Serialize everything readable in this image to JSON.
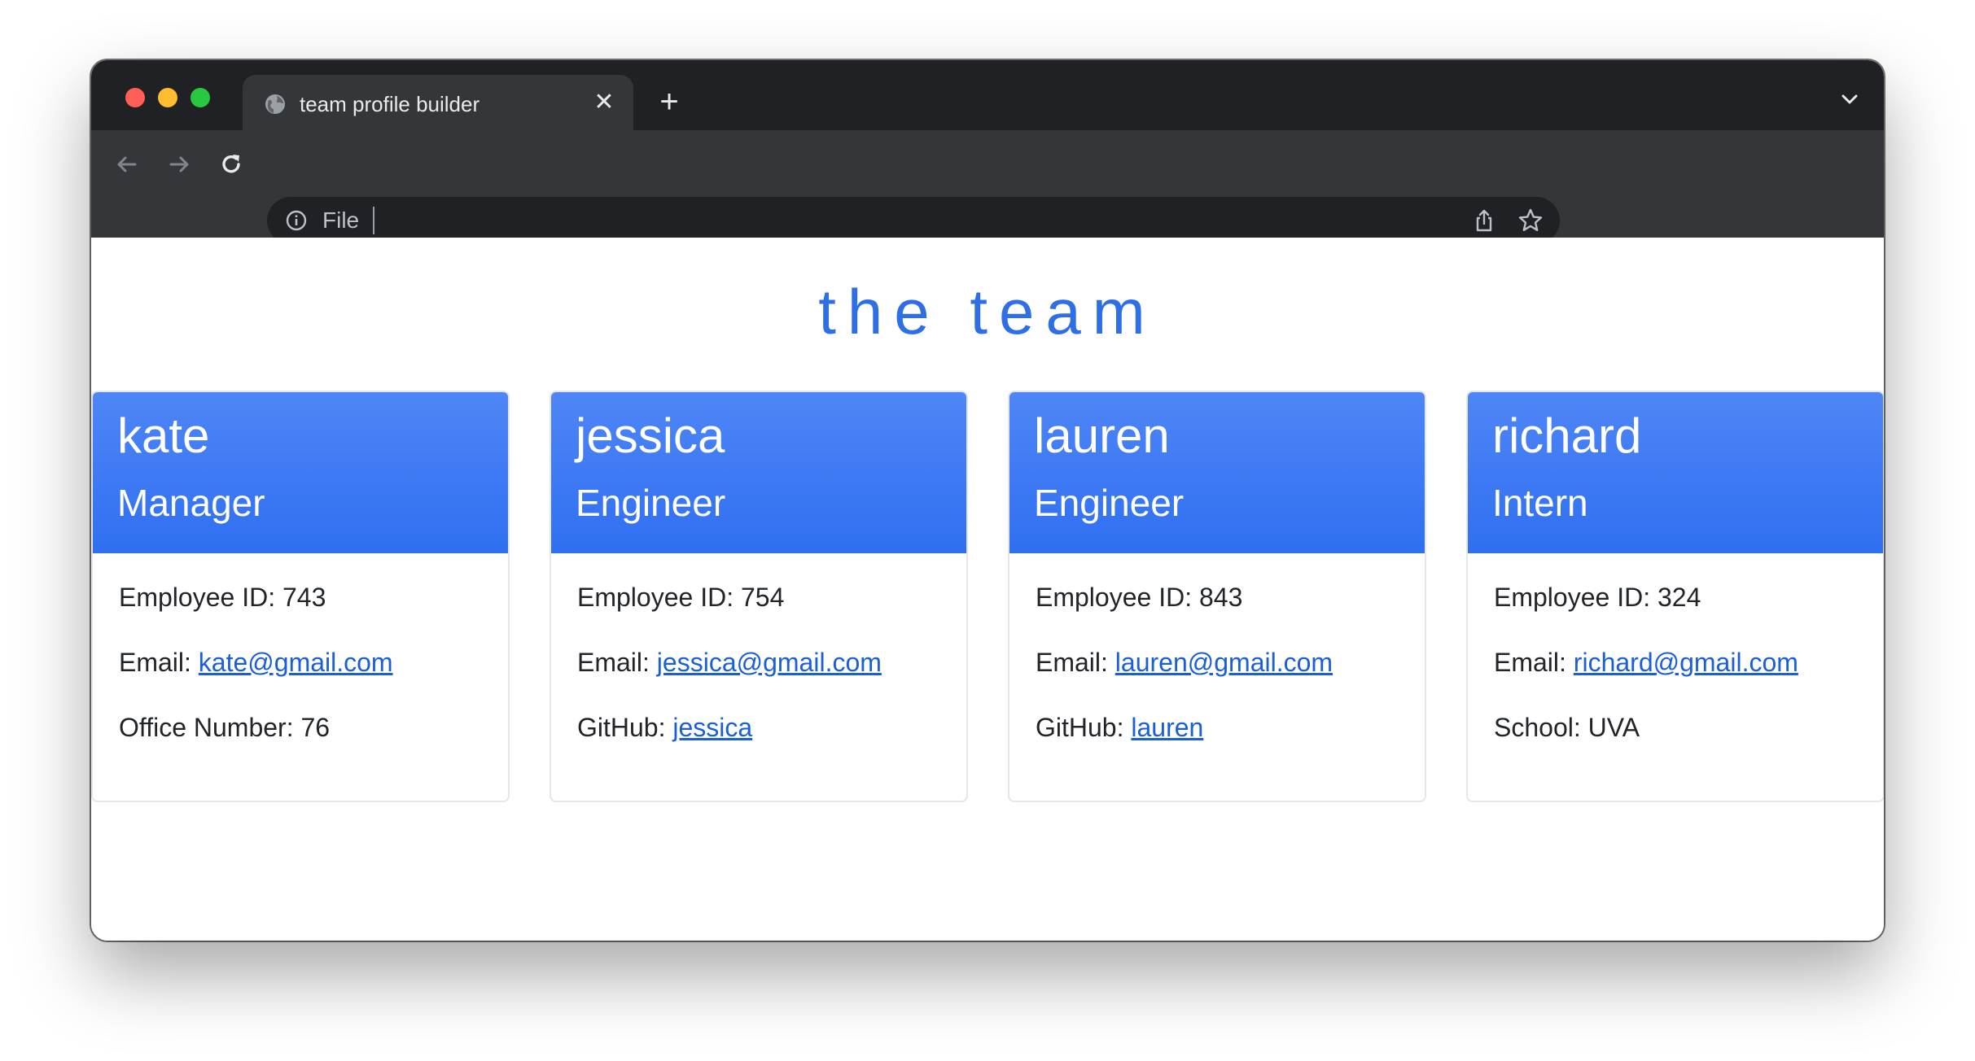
{
  "browser": {
    "tab_title": "team profile builder",
    "address_text": "File",
    "new_tab_symbol": "+",
    "close_symbol": "✕"
  },
  "page": {
    "heading": "the team",
    "accent_color": "#2f6fe6"
  },
  "team": [
    {
      "name": "kate",
      "role": "Manager",
      "id_label": "Employee ID: 743",
      "email_label": "Email: ",
      "email": "kate@gmail.com",
      "extra_label": "Office Number: 76",
      "extra_link": ""
    },
    {
      "name": "jessica",
      "role": "Engineer",
      "id_label": "Employee ID: 754",
      "email_label": "Email: ",
      "email": "jessica@gmail.com",
      "extra_label": "GitHub: ",
      "extra_link": "jessica"
    },
    {
      "name": "lauren",
      "role": "Engineer",
      "id_label": "Employee ID: 843",
      "email_label": "Email: ",
      "email": "lauren@gmail.com",
      "extra_label": "GitHub: ",
      "extra_link": "lauren"
    },
    {
      "name": "richard",
      "role": "Intern",
      "id_label": "Employee ID: 324",
      "email_label": "Email: ",
      "email": "richard@gmail.com",
      "extra_label": "School: UVA",
      "extra_link": ""
    }
  ]
}
